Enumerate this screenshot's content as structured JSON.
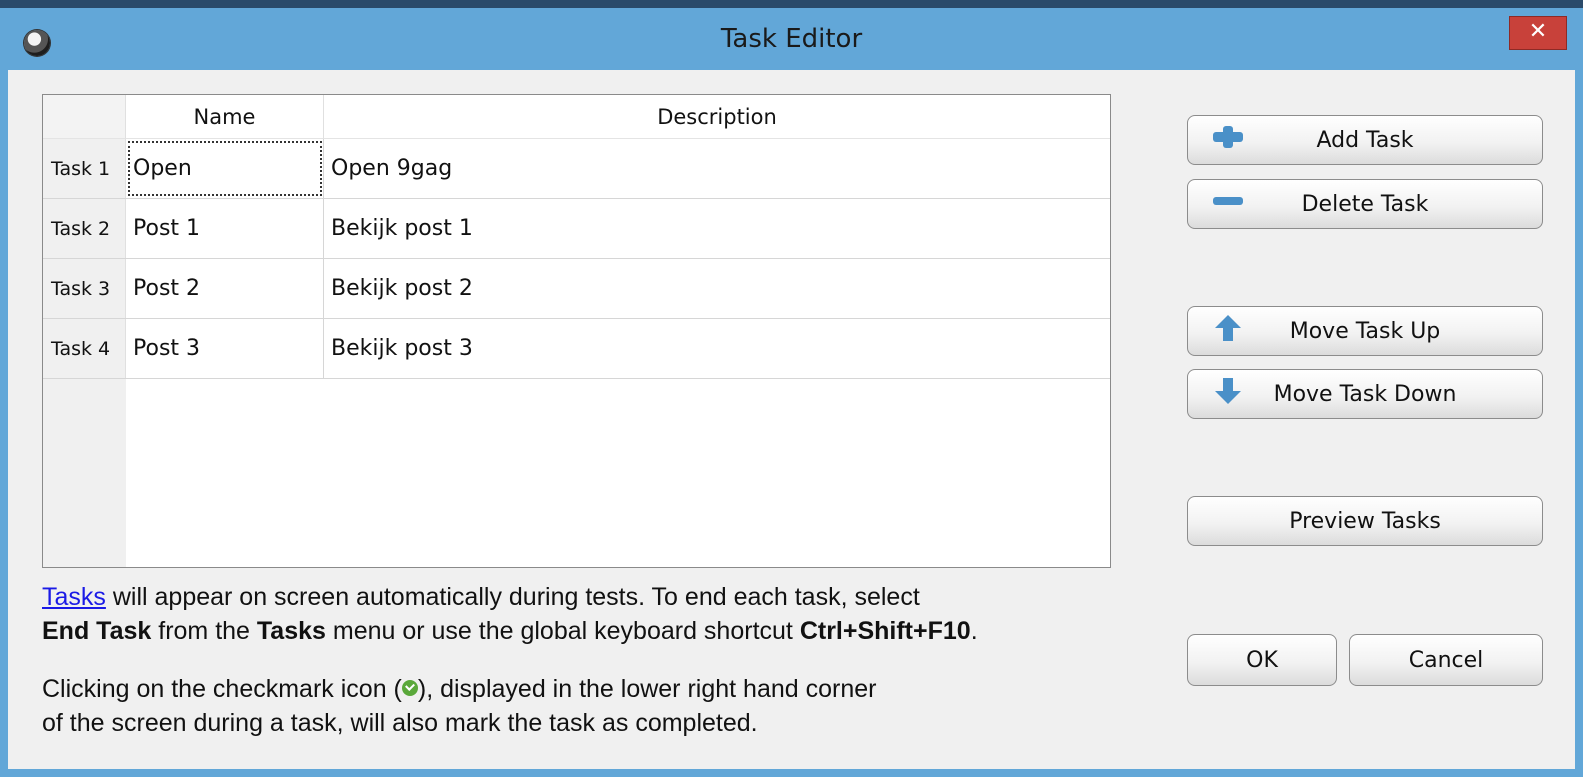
{
  "window": {
    "title": "Task Editor",
    "close_glyph": "✕"
  },
  "table": {
    "columns": [
      "Name",
      "Description"
    ],
    "rows": [
      {
        "header": "Task 1",
        "name": "Open",
        "description": "Open 9gag"
      },
      {
        "header": "Task 2",
        "name": "Post 1",
        "description": "Bekijk post 1"
      },
      {
        "header": "Task 3",
        "name": "Post 2",
        "description": "Bekijk post 2"
      },
      {
        "header": "Task 4",
        "name": "Post 3",
        "description": "Bekijk post 3"
      }
    ]
  },
  "buttons": {
    "add": "Add Task",
    "delete": "Delete Task",
    "move_up": "Move Task Up",
    "move_down": "Move Task Down",
    "preview": "Preview Tasks",
    "ok": "OK",
    "cancel": "Cancel"
  },
  "info": {
    "line1_link": "Tasks",
    "line1_rest": " will appear on screen automatically during tests. To end each task, select",
    "line2_b1": "End Task",
    "line2_t1": " from the ",
    "line2_b2": "Tasks",
    "line2_t2": " menu or use the global keyboard shortcut ",
    "line2_b3": "Ctrl+Shift+F10",
    "line2_end": ".",
    "line3_a": "Clicking on the checkmark icon (",
    "line3_b": "), displayed in the lower right hand corner",
    "line4": "of the screen during a task, will also mark the task as completed."
  },
  "colors": {
    "titlebar": "#62a7d8",
    "icon_blue": "#4a90c8",
    "close_red": "#c8413a",
    "link": "#1a1ae6"
  },
  "icons": {
    "add": "plus-icon",
    "delete": "minus-icon",
    "up": "arrow-up-icon",
    "down": "arrow-down-icon",
    "app": "app-logo-icon",
    "check": "checkmark-icon"
  }
}
